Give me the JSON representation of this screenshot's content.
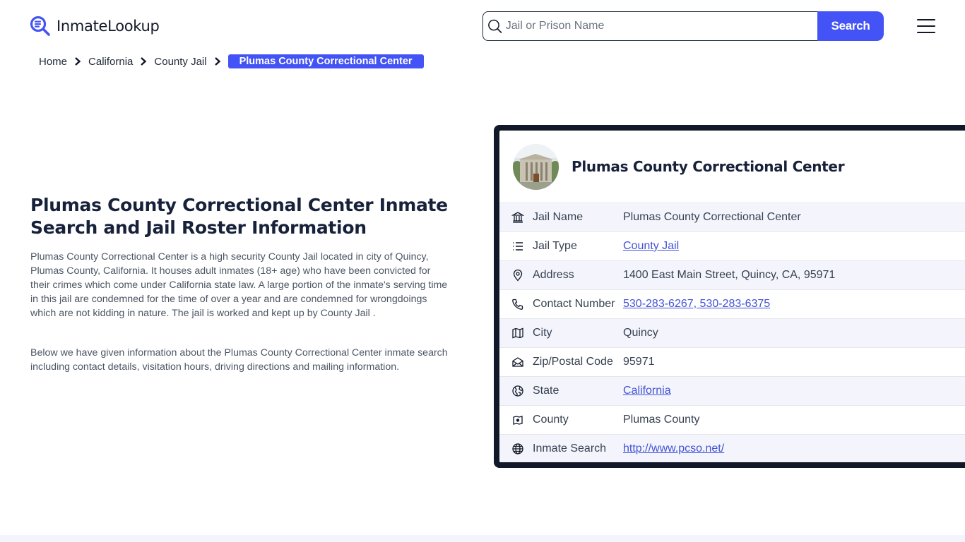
{
  "header": {
    "logo_text": "InmateLookup",
    "search": {
      "placeholder": "Jail or Prison Name",
      "value": "",
      "button_label": "Search"
    },
    "menu_icon": "hamburger-menu-icon"
  },
  "breadcrumb": {
    "items": [
      {
        "label": "Home"
      },
      {
        "label": "California"
      },
      {
        "label": "County Jail"
      }
    ],
    "current": "Plumas County Correctional Center"
  },
  "main": {
    "title": "Plumas County Correctional Center Inmate Search and Jail Roster Information",
    "paragraphs": [
      "Plumas County Correctional Center is a high security County Jail located in city of Quincy, Plumas County, California. It houses adult inmates (18+ age) who have been convicted for their crimes which come under California state law. A large portion of the inmate's serving time in this jail are condemned for the time of over a year and are condemned for wrongdoings which are not kidding in nature. The jail is worked and kept up by County Jail .",
      "Below we have given information about the Plumas County Correctional Center inmate search including contact details, visitation hours, driving directions and mailing information."
    ]
  },
  "card": {
    "title": "Plumas County Correctional Center",
    "rows": [
      {
        "icon": "bank-building-icon",
        "label": "Jail Name",
        "value": "Plumas County Correctional Center",
        "link": false
      },
      {
        "icon": "list-icon",
        "label": "Jail Type",
        "value": "County Jail",
        "link": true
      },
      {
        "icon": "map-pin-icon",
        "label": "Address",
        "value": "1400 East Main Street, Quincy, CA, 95971",
        "link": false
      },
      {
        "icon": "phone-icon",
        "label": "Contact Number",
        "value": "530-283-6267, 530-283-6375",
        "link": true
      },
      {
        "icon": "map-icon",
        "label": "City",
        "value": "Quincy",
        "link": false
      },
      {
        "icon": "mail-open-icon",
        "label": "Zip/Postal Code",
        "value": "95971",
        "link": false
      },
      {
        "icon": "globe-region-icon",
        "label": "State",
        "value": "California",
        "link": true
      },
      {
        "icon": "county-map-icon",
        "label": "County",
        "value": "Plumas County",
        "link": false
      },
      {
        "icon": "globe-icon",
        "label": "Inmate Search",
        "value": "http://www.pcso.net/",
        "link": true
      }
    ]
  },
  "colors": {
    "accent": "#4353f5",
    "card_border": "#111827",
    "row_alt": "#f4f5fc",
    "link": "#4353d6",
    "heading": "#17213a"
  }
}
